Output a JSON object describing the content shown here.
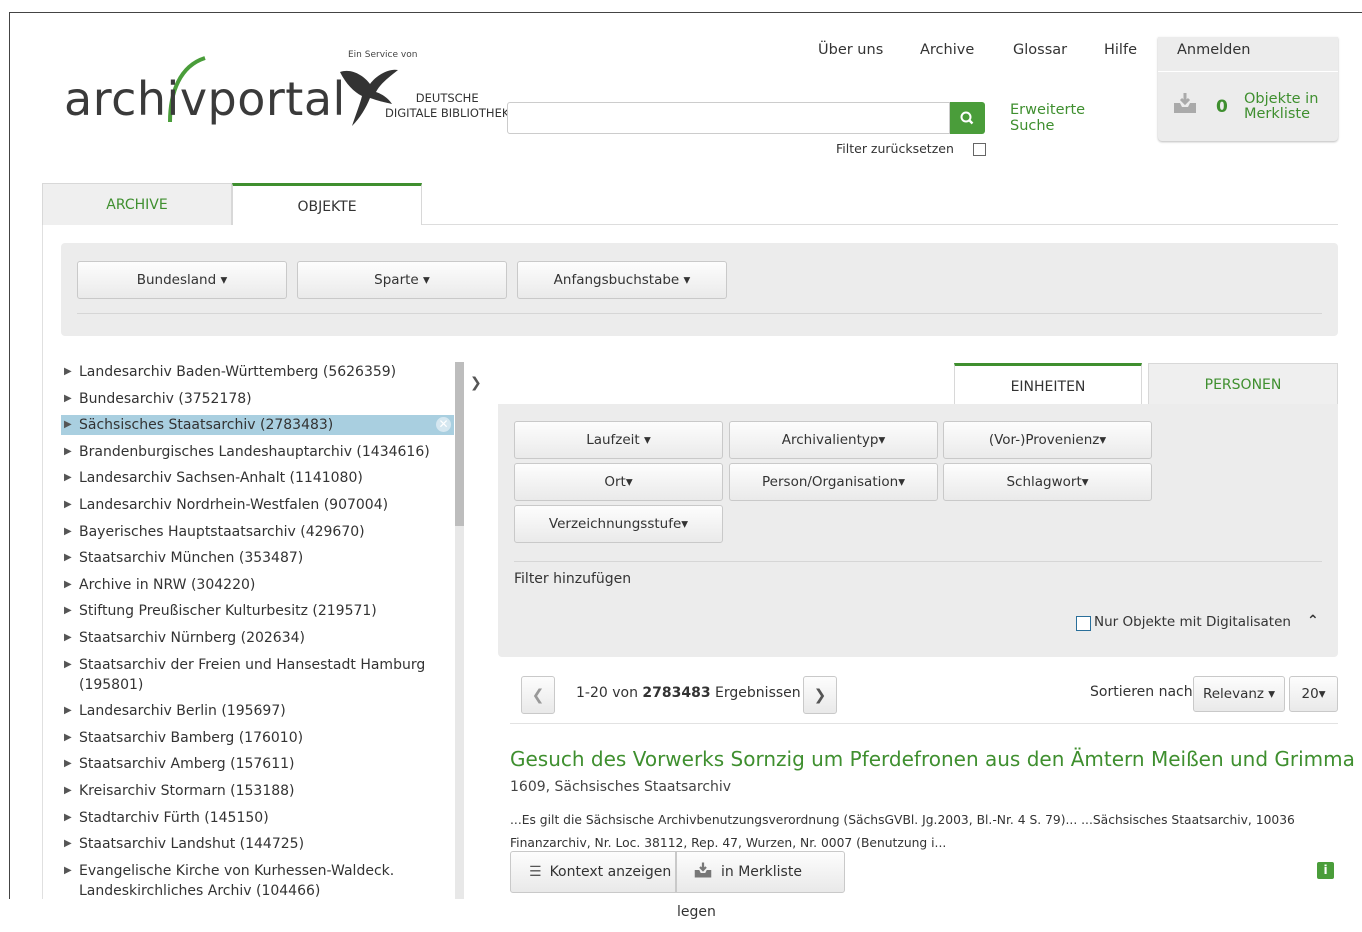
{
  "brand": {
    "logo_text": "archivportal",
    "service_prefix": "Ein Service von",
    "ddb_line1": "DEUTSCHE",
    "ddb_line2": "DIGITALE BIBLIOTHEK",
    "accent": "#3f8f2f"
  },
  "topnav": [
    "Über uns",
    "Archive",
    "Glossar",
    "Hilfe"
  ],
  "login": {
    "label": "Anmelden",
    "merk_count": "0",
    "merk_line1": "Objekte in",
    "merk_line2": "Merkliste"
  },
  "search": {
    "value": "",
    "icon": "search-icon",
    "extended_line1": "Erweiterte",
    "extended_line2": "Suche",
    "filter_reset": "Filter zurücksetzen"
  },
  "main_tabs": [
    "ARCHIVE",
    "OBJEKTE"
  ],
  "top_filters": [
    "Bundesland",
    "Sparte",
    "Anfangsbuchstabe"
  ],
  "archives": [
    {
      "label": "Landesarchiv Baden-Württemberg (5626359)"
    },
    {
      "label": "Bundesarchiv (3752178)"
    },
    {
      "label": "Sächsisches Staatsarchiv (2783483)",
      "selected": true
    },
    {
      "label": "Brandenburgisches Landeshauptarchiv (1434616)"
    },
    {
      "label": "Landesarchiv Sachsen-Anhalt (1141080)"
    },
    {
      "label": "Landesarchiv Nordrhein-Westfalen (907004)"
    },
    {
      "label": "Bayerisches Hauptstaatsarchiv (429670)"
    },
    {
      "label": "Staatsarchiv München (353487)"
    },
    {
      "label": "Archive in NRW (304220)"
    },
    {
      "label": "Stiftung Preußischer Kulturbesitz (219571)"
    },
    {
      "label": "Staatsarchiv Nürnberg (202634)"
    },
    {
      "label": "Staatsarchiv der Freien und Hansestadt Hamburg (195801)"
    },
    {
      "label": "Landesarchiv Berlin (195697)"
    },
    {
      "label": "Staatsarchiv Bamberg (176010)"
    },
    {
      "label": "Staatsarchiv Amberg (157611)"
    },
    {
      "label": "Kreisarchiv Stormarn (153188)"
    },
    {
      "label": "Stadtarchiv Fürth (145150)"
    },
    {
      "label": "Staatsarchiv Landshut (144725)"
    },
    {
      "label": "Evangelische Kirche von Kurhessen-Waldeck. Landeskirchliches Archiv (104466)"
    }
  ],
  "sub_tabs": [
    "EINHEITEN",
    "PERSONEN"
  ],
  "facets": [
    "Laufzeit",
    "Archivalientyp",
    "(Vor-)Provenienz",
    "Ort",
    "Person/Organisation",
    "Schlagwort",
    "Verzeichnungsstufe"
  ],
  "add_filter": "Filter hinzufügen",
  "digital_only": "Nur Objekte mit Digitalisaten",
  "results": {
    "range": "1-20 von ",
    "total": "2783483",
    "suffix": " Ergebnissen",
    "sort_label": "Sortieren nach",
    "sort_value": "Relevanz",
    "page_size": "20"
  },
  "result_item": {
    "title": "Gesuch des Vorwerks Sornzig um Pferdefronen aus den Ämtern Meißen und Grimma",
    "subtitle": "1609, Sächsisches Staatsarchiv",
    "snippet": "...Es gilt die Sächsische Archivbenutzungsverordnung (SächsGVBl. Jg.2003, Bl.-Nr. 4 S. 79)... ...Sächsisches Staatsarchiv, 10036 Finanzarchiv, Nr. Loc. 38112, Rep. 47, Wurzen, Nr. 0007 (Benutzung i...",
    "context_btn": "Kontext anzeigen",
    "merk_btn": "in Merkliste legen",
    "info": "i"
  }
}
